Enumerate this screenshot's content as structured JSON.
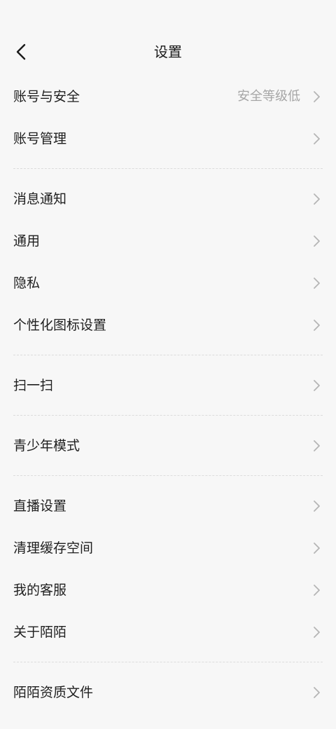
{
  "header": {
    "title": "设置",
    "back_icon": "chevron-left-icon"
  },
  "groups": [
    {
      "items": [
        {
          "label": "账号与安全",
          "value": "安全等级低"
        },
        {
          "label": "账号管理"
        }
      ]
    },
    {
      "items": [
        {
          "label": "消息通知"
        },
        {
          "label": "通用"
        },
        {
          "label": "隐私"
        },
        {
          "label": "个性化图标设置"
        }
      ]
    },
    {
      "items": [
        {
          "label": "扫一扫"
        }
      ]
    },
    {
      "items": [
        {
          "label": "青少年模式"
        }
      ]
    },
    {
      "items": [
        {
          "label": "直播设置"
        },
        {
          "label": "清理缓存空间"
        },
        {
          "label": "我的客服"
        },
        {
          "label": "关于陌陌"
        }
      ]
    },
    {
      "items": [
        {
          "label": "陌陌资质文件"
        }
      ]
    }
  ],
  "icons": {
    "row_arrow": "chevron-right-icon"
  },
  "colors": {
    "background": "#f7f7f7",
    "text": "#1f1f1f",
    "secondary_text": "#a6a6a6",
    "chevron": "#b5b5b5",
    "divider": "#dcdcdc"
  }
}
